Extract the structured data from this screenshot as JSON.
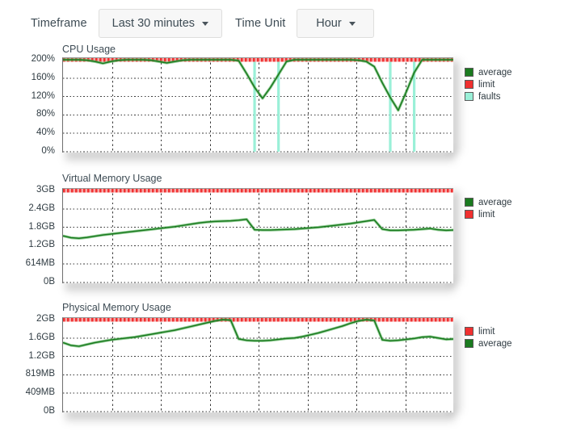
{
  "toolbar": {
    "timeframe_label": "Timeframe",
    "timeframe_value": "Last 30 minutes",
    "timeunit_label": "Time Unit",
    "timeunit_value": "Hour"
  },
  "colors": {
    "average": "#1a7a1f",
    "average_soft": "#5bb35f",
    "limit": "#f03030",
    "faults": "#9af0d8",
    "grid": "#3a3a3a",
    "axis": "#6f6f6f",
    "text": "#3d4b54"
  },
  "chart_data": [
    {
      "id": "cpu-usage",
      "type": "line",
      "title": "CPU Usage",
      "xlabel": "",
      "ylabel": "",
      "ylim": [
        0,
        200
      ],
      "yticks": [
        200,
        160,
        120,
        80,
        40,
        0
      ],
      "ytick_labels": [
        "200%",
        "160%",
        "120%",
        "80%",
        "40%",
        "0%"
      ],
      "grid": true,
      "vgridlines": 7,
      "legend_position": "right",
      "legend": [
        "average",
        "limit",
        "faults"
      ],
      "series": [
        {
          "name": "average",
          "color": "#1a7a1f",
          "values": [
            200,
            200,
            200,
            199,
            196,
            192,
            196,
            199,
            200,
            200,
            200,
            199,
            196,
            193,
            196,
            199,
            200,
            200,
            200,
            200,
            200,
            200,
            198,
            170,
            140,
            116,
            140,
            168,
            196,
            200,
            200,
            200,
            200,
            200,
            200,
            200,
            200,
            199,
            196,
            185,
            150,
            118,
            90,
            130,
            172,
            200,
            200,
            200,
            200,
            200
          ]
        },
        {
          "name": "limit",
          "color": "#f03030",
          "constant": 200
        }
      ],
      "faults": [
        {
          "x_index": 24,
          "value": 200
        },
        {
          "x_index": 27,
          "value": 200
        },
        {
          "x_index": 41,
          "value": 200
        },
        {
          "x_index": 44,
          "value": 200
        }
      ]
    },
    {
      "id": "virtual-memory-usage",
      "type": "line",
      "title": "Virtual Memory Usage",
      "xlabel": "",
      "ylabel": "",
      "ylim": [
        0,
        3
      ],
      "yticks": [
        3,
        2.4,
        1.8,
        1.2,
        0.6,
        0
      ],
      "ytick_labels": [
        "3GB",
        "2.4GB",
        "1.8GB",
        "1.2GB",
        "614MB",
        "0B"
      ],
      "grid": true,
      "vgridlines": 7,
      "legend_position": "right",
      "legend": [
        "average",
        "limit"
      ],
      "series": [
        {
          "name": "average",
          "color": "#1a7a1f",
          "values": [
            1.52,
            1.46,
            1.44,
            1.47,
            1.51,
            1.55,
            1.58,
            1.61,
            1.64,
            1.67,
            1.7,
            1.73,
            1.76,
            1.79,
            1.82,
            1.86,
            1.9,
            1.94,
            1.97,
            1.99,
            2.0,
            2.01,
            2.03,
            2.06,
            1.72,
            1.71,
            1.71,
            1.72,
            1.73,
            1.74,
            1.76,
            1.78,
            1.8,
            1.83,
            1.86,
            1.89,
            1.92,
            1.96,
            2.0,
            2.04,
            1.74,
            1.7,
            1.7,
            1.71,
            1.72,
            1.74,
            1.76,
            1.72,
            1.7,
            1.71
          ]
        },
        {
          "name": "limit",
          "color": "#f03030",
          "constant": 3
        }
      ],
      "faults": []
    },
    {
      "id": "physical-memory-usage",
      "type": "line",
      "title": "Physical Memory Usage",
      "xlabel": "",
      "ylabel": "",
      "ylim": [
        0,
        2
      ],
      "yticks": [
        2,
        1.6,
        1.2,
        0.8,
        0.4,
        0
      ],
      "ytick_labels": [
        "2GB",
        "1.6GB",
        "1.2GB",
        "819MB",
        "409MB",
        "0B"
      ],
      "grid": true,
      "vgridlines": 7,
      "legend_position": "right",
      "legend": [
        "limit",
        "average"
      ],
      "series": [
        {
          "name": "average",
          "color": "#1a7a1f",
          "values": [
            1.5,
            1.44,
            1.42,
            1.46,
            1.5,
            1.53,
            1.56,
            1.58,
            1.6,
            1.62,
            1.65,
            1.68,
            1.71,
            1.74,
            1.77,
            1.81,
            1.85,
            1.89,
            1.93,
            1.97,
            2.0,
            1.99,
            1.58,
            1.55,
            1.54,
            1.54,
            1.55,
            1.57,
            1.59,
            1.6,
            1.63,
            1.67,
            1.71,
            1.76,
            1.81,
            1.86,
            1.92,
            1.97,
            2.0,
            1.98,
            1.56,
            1.54,
            1.55,
            1.57,
            1.59,
            1.62,
            1.63,
            1.6,
            1.57,
            1.58
          ]
        },
        {
          "name": "limit",
          "color": "#f03030",
          "constant": 2
        }
      ],
      "faults": []
    }
  ]
}
